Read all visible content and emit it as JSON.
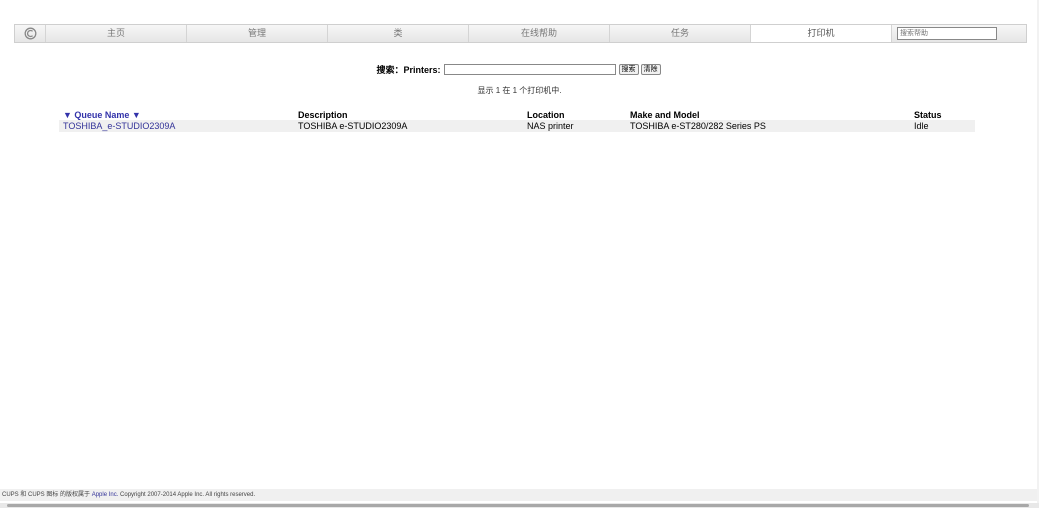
{
  "nav": {
    "items": [
      {
        "label": "主页"
      },
      {
        "label": "管理"
      },
      {
        "label": "类"
      },
      {
        "label": "在线帮助"
      },
      {
        "label": "任务"
      },
      {
        "label": "打印机"
      }
    ],
    "search_placeholder": "搜索帮助",
    "logo_icon": "cups-logo-icon"
  },
  "search": {
    "label": "搜索：Printers:",
    "value": "",
    "search_button": "搜索",
    "clear_button": "清除"
  },
  "showing": "显示 1 在 1 个打印机中.",
  "table": {
    "headers": {
      "queue": "▼ Queue Name ▼",
      "description": "Description",
      "location": "Location",
      "model": "Make and Model",
      "status": "Status"
    },
    "rows": [
      {
        "queue": "TOSHIBA_e-STUDIO2309A",
        "description": "TOSHIBA e-STUDIO2309A",
        "location": "NAS printer",
        "model": "TOSHIBA e-ST280/282 Series PS",
        "status": "Idle"
      }
    ]
  },
  "footer": {
    "prefix": "CUPS 和 CUPS 图标 的版权属于 ",
    "link": "Apple Inc.",
    "suffix": " Copyright 2007-2014 Apple Inc. All rights reserved."
  },
  "colors": {
    "link": "#333399",
    "row_background": "#f0f0f0"
  }
}
